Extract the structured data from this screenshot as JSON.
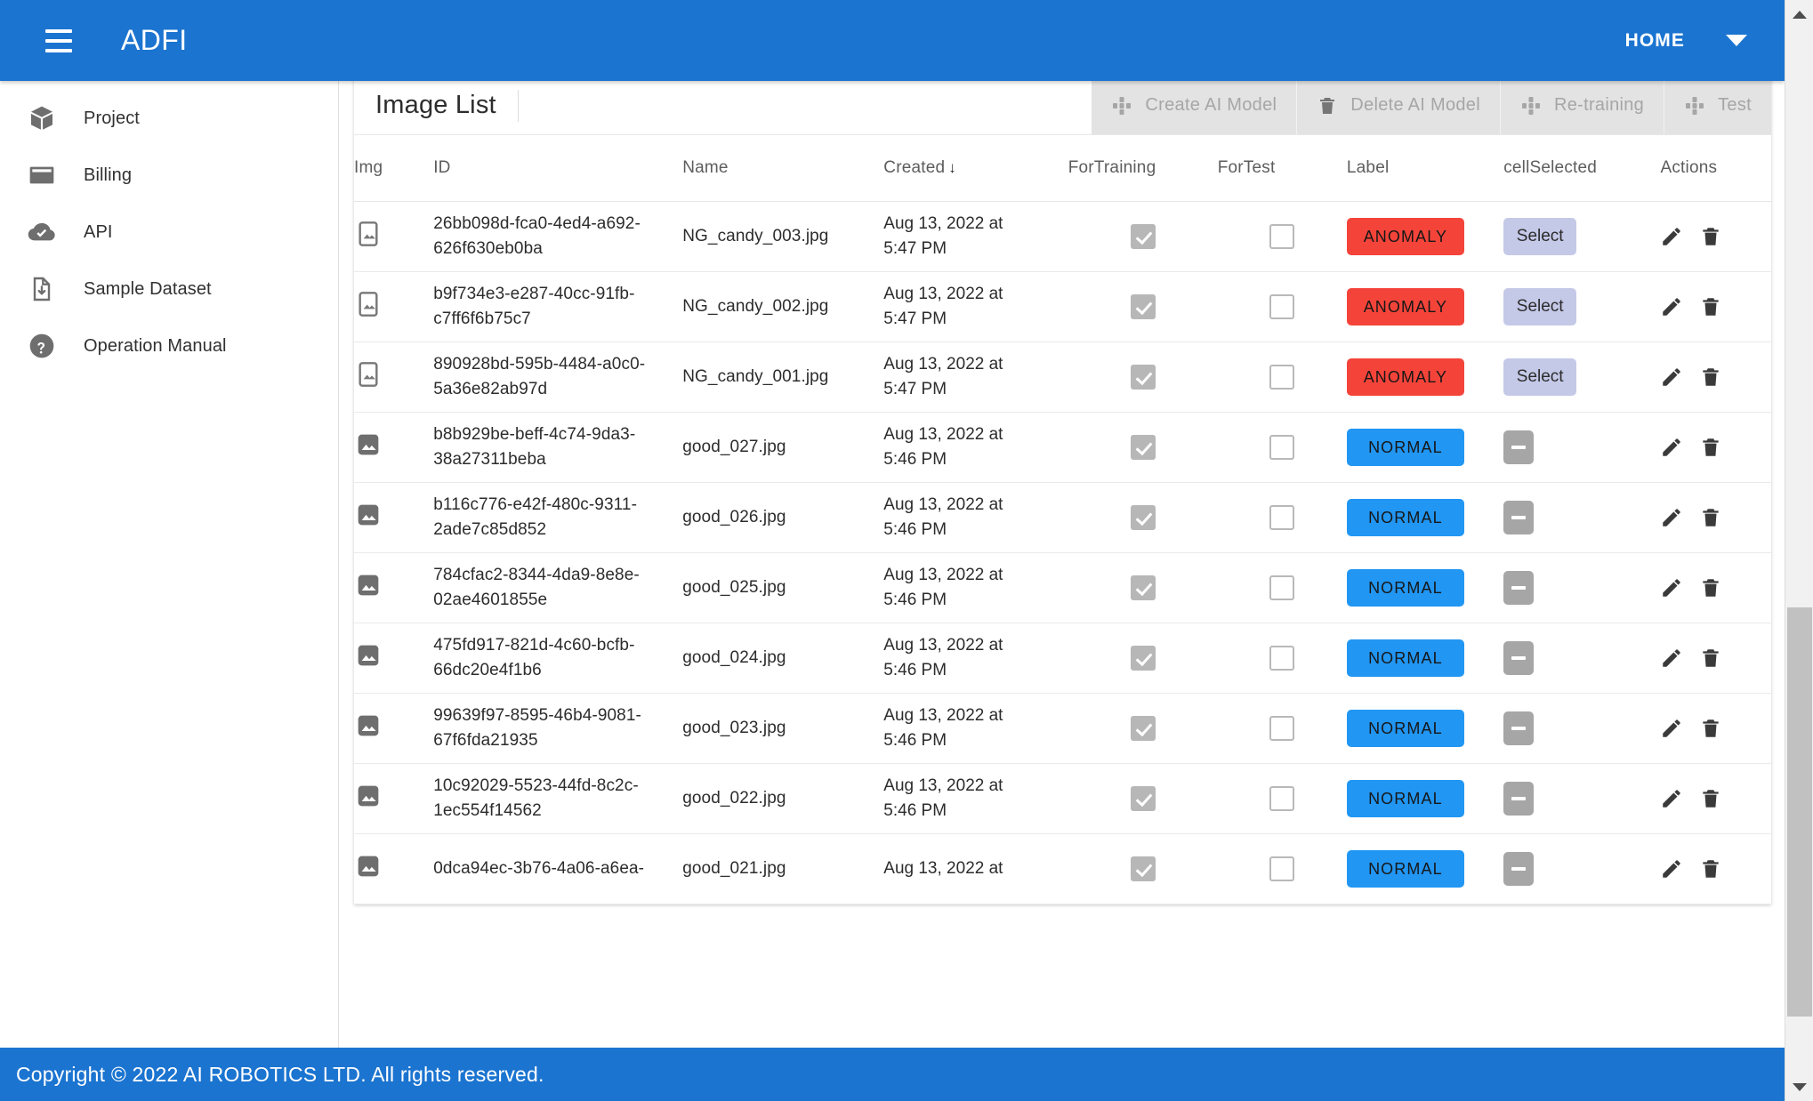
{
  "appbar": {
    "menu_icon": "hamburger-menu-icon",
    "title": "ADFI",
    "home_label": "HOME",
    "caret_icon": "chevron-down-icon",
    "background": "#1b74d0"
  },
  "sidebar": {
    "items": [
      {
        "label": "Project",
        "icon": "box-icon"
      },
      {
        "label": "Billing",
        "icon": "credit-card-icon"
      },
      {
        "label": "API",
        "icon": "cloud-check-icon"
      },
      {
        "label": "Sample Dataset",
        "icon": "file-download-icon"
      },
      {
        "label": "Operation Manual",
        "icon": "help-circle-icon"
      }
    ]
  },
  "panel": {
    "title": "Image List",
    "toolbar": [
      {
        "label": "Create AI Model",
        "icon": "model-grid-icon",
        "disabled": true
      },
      {
        "label": "Delete AI Model",
        "icon": "trash-icon",
        "disabled": true
      },
      {
        "label": "Re-training",
        "icon": "model-grid-icon",
        "disabled": true
      },
      {
        "label": "Test",
        "icon": "model-grid-icon",
        "disabled": true
      }
    ]
  },
  "table": {
    "columns": [
      {
        "key": "img",
        "label": "Img"
      },
      {
        "key": "id",
        "label": "ID"
      },
      {
        "key": "name",
        "label": "Name"
      },
      {
        "key": "created",
        "label": "Created",
        "sorted": "desc",
        "sort_icon": "arrow-down-icon"
      },
      {
        "key": "training",
        "label": "ForTraining"
      },
      {
        "key": "test",
        "label": "ForTest"
      },
      {
        "key": "label",
        "label": "Label"
      },
      {
        "key": "cell",
        "label": "cellSelected"
      },
      {
        "key": "actions",
        "label": "Actions"
      }
    ],
    "rows": [
      {
        "thumb": "image-placeholder-outline-icon",
        "id": "26bb098d-fca0-4ed4-a692-626f630eb0ba",
        "name": "NG_candy_003.jpg",
        "created_date": "Aug 13, 2022 at",
        "created_time": "5:47 PM",
        "for_training": true,
        "for_test": false,
        "label": "ANOMALY",
        "label_kind": "anomaly",
        "cell_selected": "Select",
        "cell_kind": "select"
      },
      {
        "thumb": "image-placeholder-outline-icon",
        "id": "b9f734e3-e287-40cc-91fb-c7ff6f6b75c7",
        "name": "NG_candy_002.jpg",
        "created_date": "Aug 13, 2022 at",
        "created_time": "5:47 PM",
        "for_training": true,
        "for_test": false,
        "label": "ANOMALY",
        "label_kind": "anomaly",
        "cell_selected": "Select",
        "cell_kind": "select"
      },
      {
        "thumb": "image-placeholder-outline-icon",
        "id": "890928bd-595b-4484-a0c0-5a36e82ab97d",
        "name": "NG_candy_001.jpg",
        "created_date": "Aug 13, 2022 at",
        "created_time": "5:47 PM",
        "for_training": true,
        "for_test": false,
        "label": "ANOMALY",
        "label_kind": "anomaly",
        "cell_selected": "Select",
        "cell_kind": "select"
      },
      {
        "thumb": "image-filled-icon",
        "id": "b8b929be-beff-4c74-9da3-38a27311beba",
        "name": "good_027.jpg",
        "created_date": "Aug 13, 2022 at",
        "created_time": "5:46 PM",
        "for_training": true,
        "for_test": false,
        "label": "NORMAL",
        "label_kind": "normal",
        "cell_selected": "",
        "cell_kind": "minus"
      },
      {
        "thumb": "image-filled-icon",
        "id": "b116c776-e42f-480c-9311-2ade7c85d852",
        "name": "good_026.jpg",
        "created_date": "Aug 13, 2022 at",
        "created_time": "5:46 PM",
        "for_training": true,
        "for_test": false,
        "label": "NORMAL",
        "label_kind": "normal",
        "cell_selected": "",
        "cell_kind": "minus"
      },
      {
        "thumb": "image-filled-icon",
        "id": "784cfac2-8344-4da9-8e8e-02ae4601855e",
        "name": "good_025.jpg",
        "created_date": "Aug 13, 2022 at",
        "created_time": "5:46 PM",
        "for_training": true,
        "for_test": false,
        "label": "NORMAL",
        "label_kind": "normal",
        "cell_selected": "",
        "cell_kind": "minus"
      },
      {
        "thumb": "image-filled-icon",
        "id": "475fd917-821d-4c60-bcfb-66dc20e4f1b6",
        "name": "good_024.jpg",
        "created_date": "Aug 13, 2022 at",
        "created_time": "5:46 PM",
        "for_training": true,
        "for_test": false,
        "label": "NORMAL",
        "label_kind": "normal",
        "cell_selected": "",
        "cell_kind": "minus"
      },
      {
        "thumb": "image-filled-icon",
        "id": "99639f97-8595-46b4-9081-67f6fda21935",
        "name": "good_023.jpg",
        "created_date": "Aug 13, 2022 at",
        "created_time": "5:46 PM",
        "for_training": true,
        "for_test": false,
        "label": "NORMAL",
        "label_kind": "normal",
        "cell_selected": "",
        "cell_kind": "minus"
      },
      {
        "thumb": "image-filled-icon",
        "id": "10c92029-5523-44fd-8c2c-1ec554f14562",
        "name": "good_022.jpg",
        "created_date": "Aug 13, 2022 at",
        "created_time": "5:46 PM",
        "for_training": true,
        "for_test": false,
        "label": "NORMAL",
        "label_kind": "normal",
        "cell_selected": "",
        "cell_kind": "minus"
      },
      {
        "thumb": "image-filled-icon",
        "id": "0dca94ec-3b76-4a06-a6ea-",
        "name": "good_021.jpg",
        "created_date": "Aug 13, 2022 at",
        "created_time": "",
        "for_training": true,
        "for_test": false,
        "label": "NORMAL",
        "label_kind": "normal",
        "cell_selected": "",
        "cell_kind": "minus"
      }
    ],
    "row_actions": [
      {
        "icon": "edit-pencil-icon"
      },
      {
        "icon": "delete-trash-icon"
      }
    ]
  },
  "footer": {
    "text": "Copyright © 2022 AI ROBOTICS LTD. All rights reserved.",
    "background": "#1b74d0"
  },
  "scrollbar": {
    "up_icon": "scroll-up-arrow-icon",
    "down_icon": "scroll-down-arrow-icon"
  },
  "colors": {
    "brand_blue": "#1b74d0",
    "anomaly_red": "#f4443a",
    "normal_blue": "#2196f3",
    "select_lavender": "#c5c9e8",
    "disabled_gray": "#a6a6a6"
  }
}
